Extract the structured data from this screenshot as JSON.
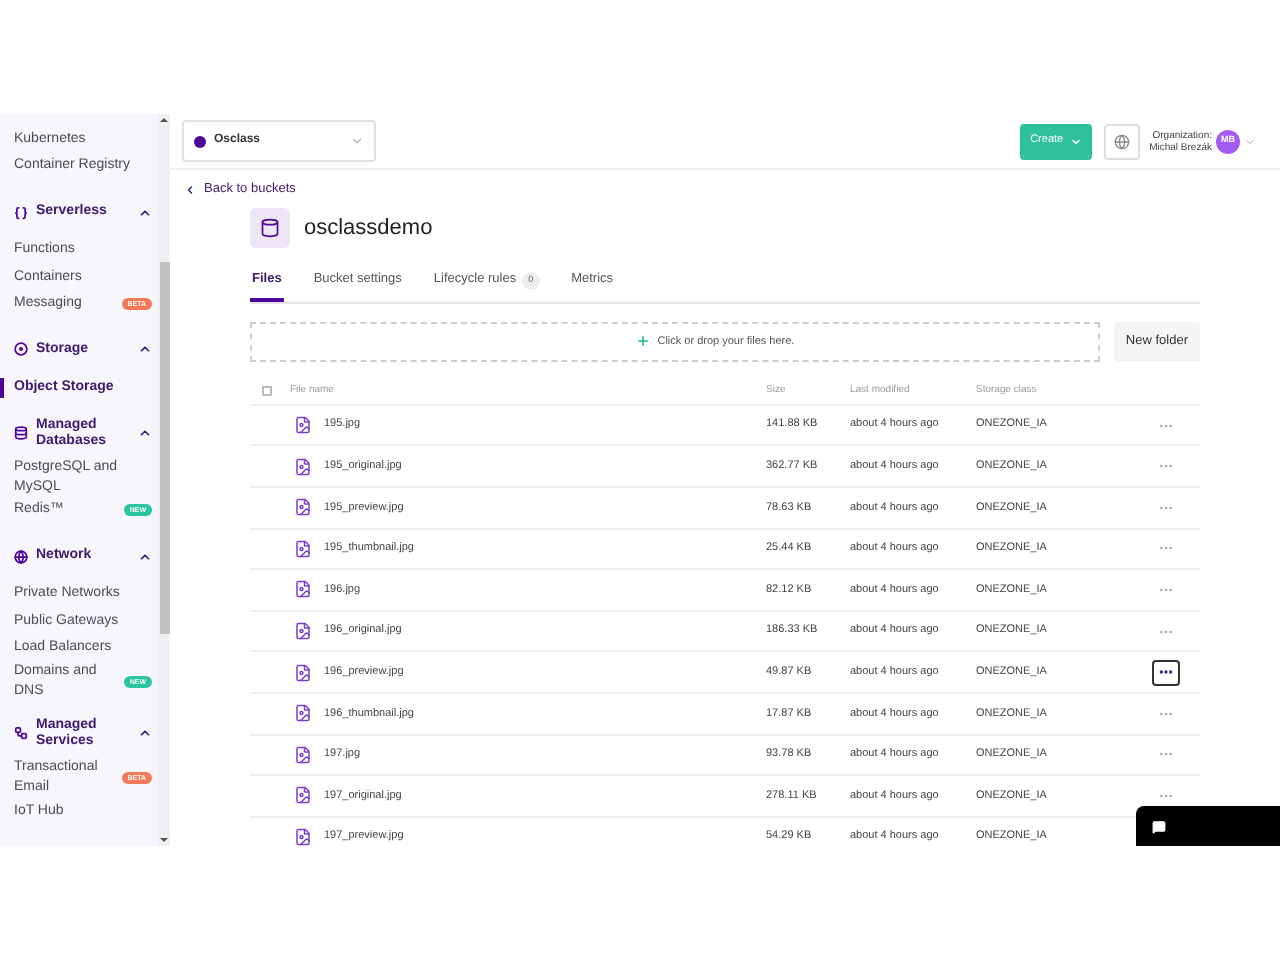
{
  "sidebar": {
    "items": [
      {
        "kind": "item",
        "label": "Kubernetes",
        "selected": false
      },
      {
        "kind": "item",
        "label": "Container Registry",
        "selected": false
      },
      {
        "kind": "group",
        "label": "Serverless",
        "expanded": true
      },
      {
        "kind": "item",
        "label": "Functions",
        "selected": false
      },
      {
        "kind": "item",
        "label": "Containers",
        "selected": false
      },
      {
        "kind": "item",
        "label": "Messaging",
        "selected": false,
        "badge": "BETA",
        "color": "#f0795a"
      },
      {
        "kind": "group",
        "label": "Storage",
        "expanded": true
      },
      {
        "kind": "item",
        "label": "Object Storage",
        "selected": true
      },
      {
        "kind": "group",
        "label": "Managed Databases",
        "expanded": true
      },
      {
        "kind": "item",
        "label": "PostgreSQL and MySQL",
        "selected": false
      },
      {
        "kind": "item",
        "label": "Redis™",
        "selected": false,
        "badge": "NEW",
        "color": "#2bc4a0"
      },
      {
        "kind": "group",
        "label": "Network",
        "expanded": true
      },
      {
        "kind": "item",
        "label": "Private Networks",
        "selected": false
      },
      {
        "kind": "item",
        "label": "Public Gateways",
        "selected": false
      },
      {
        "kind": "item",
        "label": "Load Balancers",
        "selected": false
      },
      {
        "kind": "item",
        "label": "Domains and DNS",
        "selected": false,
        "badge": "NEW",
        "color": "#2bc4a0"
      },
      {
        "kind": "group",
        "label": "Managed Services",
        "expanded": true
      },
      {
        "kind": "item",
        "label": "Transactional Email",
        "selected": false,
        "badge": "BETA",
        "color": "#f0795a"
      },
      {
        "kind": "item",
        "label": "IoT Hub",
        "selected": false
      }
    ]
  },
  "topbar": {
    "project": "Osclass",
    "create": "Create",
    "organization_label": "Organization:",
    "organization": "Michal Brezák",
    "avatar": "MB"
  },
  "back_link": "Back to buckets",
  "bucket": {
    "title": "osclassdemo"
  },
  "tabs": [
    {
      "label": "Files",
      "selected": true
    },
    {
      "label": "Bucket settings",
      "selected": false
    },
    {
      "label": "Lifecycle rules",
      "selected": false,
      "count": "0"
    },
    {
      "label": "Metrics",
      "selected": false
    }
  ],
  "dropzone": "Click or drop your files here.",
  "new_folder": "New folder",
  "table": {
    "select_all": {
      "checked": false
    },
    "columns": [
      "File name",
      "Size",
      "Last modified",
      "Storage class"
    ],
    "rows": [
      {
        "name": "195.jpg",
        "size": "141.88 KB",
        "modified": "about 4 hours ago",
        "class": "ONEZONE_IA",
        "menu_focused": false
      },
      {
        "name": "195_original.jpg",
        "size": "362.77 KB",
        "modified": "about 4 hours ago",
        "class": "ONEZONE_IA",
        "menu_focused": false
      },
      {
        "name": "195_preview.jpg",
        "size": "78.63 KB",
        "modified": "about 4 hours ago",
        "class": "ONEZONE_IA",
        "menu_focused": false
      },
      {
        "name": "195_thumbnail.jpg",
        "size": "25.44 KB",
        "modified": "about 4 hours ago",
        "class": "ONEZONE_IA",
        "menu_focused": false
      },
      {
        "name": "196.jpg",
        "size": "82.12 KB",
        "modified": "about 4 hours ago",
        "class": "ONEZONE_IA",
        "menu_focused": false
      },
      {
        "name": "196_original.jpg",
        "size": "186.33 KB",
        "modified": "about 4 hours ago",
        "class": "ONEZONE_IA",
        "menu_focused": false
      },
      {
        "name": "196_preview.jpg",
        "size": "49.87 KB",
        "modified": "about 4 hours ago",
        "class": "ONEZONE_IA",
        "menu_focused": true
      },
      {
        "name": "196_thumbnail.jpg",
        "size": "17.87 KB",
        "modified": "about 4 hours ago",
        "class": "ONEZONE_IA",
        "menu_focused": false
      },
      {
        "name": "197.jpg",
        "size": "93.78 KB",
        "modified": "about 4 hours ago",
        "class": "ONEZONE_IA",
        "menu_focused": false
      },
      {
        "name": "197_original.jpg",
        "size": "278.11 KB",
        "modified": "about 4 hours ago",
        "class": "ONEZONE_IA",
        "menu_focused": false
      },
      {
        "name": "197_preview.jpg",
        "size": "54.29 KB",
        "modified": "about 4 hours ago",
        "class": "ONEZONE_IA"
      }
    ]
  }
}
